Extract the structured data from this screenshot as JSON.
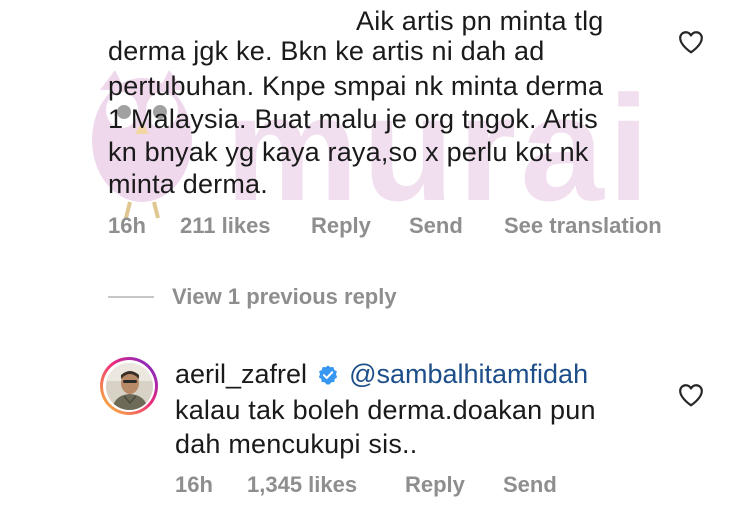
{
  "comment": {
    "lines": [
      "Aik artis pn minta tlg",
      "derma jgk ke. Bkn ke artis ni dah ad",
      "pertubuhan. Knpe smpai nk minta derma",
      "1 Malaysia. Buat malu je org tngok. Artis",
      "kn bnyak yg kaya raya,so x perlu kot nk",
      "minta derma."
    ],
    "time": "16h",
    "likes": "211 likes",
    "reply_label": "Reply",
    "send_label": "Send",
    "translate_label": "See translation"
  },
  "view_replies_label": "View 1 previous reply",
  "reply": {
    "username": "aeril_zafrel",
    "mention": "@sambalhitamfidah",
    "lines": [
      "kalau tak boleh derma.doakan pun",
      "dah mencukupi sis.."
    ],
    "time": "16h",
    "likes": "1,345 likes",
    "reply_label": "Reply",
    "send_label": "Send"
  },
  "watermark": {
    "text": "murai"
  },
  "icons": {
    "like": "heart-outline-icon",
    "verified": "verified-badge-icon"
  },
  "colors": {
    "meta_gray": "#8e8e8e",
    "mention_blue": "#1d4e89",
    "verified_blue": "#3897f0",
    "watermark_pink": "#d9a6d4"
  }
}
